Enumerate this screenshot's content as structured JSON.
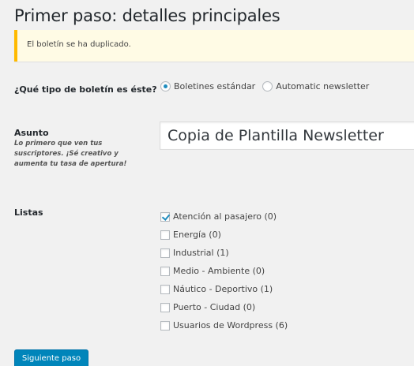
{
  "page_title": "Primer paso: detalles principales",
  "notice": {
    "text": "El boletín se ha duplicado."
  },
  "newsletter_type": {
    "label": "¿Qué tipo de boletín es éste?",
    "options": [
      {
        "label": "Boletines estándar",
        "selected": true
      },
      {
        "label": "Automatic newsletter",
        "selected": false
      }
    ]
  },
  "subject": {
    "label": "Asunto",
    "help": "Lo primero que ven tus suscriptores. ¡Sé creativo y aumenta tu tasa de apertura!",
    "value": "Copia de Plantilla Newsletter"
  },
  "lists": {
    "label": "Listas",
    "items": [
      {
        "label": "Atención al pasajero (0)",
        "checked": true
      },
      {
        "label": "Energía (0)",
        "checked": false
      },
      {
        "label": "Industrial (1)",
        "checked": false
      },
      {
        "label": "Medio - Ambiente (0)",
        "checked": false
      },
      {
        "label": "Náutico - Deportivo (1)",
        "checked": false
      },
      {
        "label": "Puerto - Ciudad (0)",
        "checked": false
      },
      {
        "label": "Usuarios de Wordpress (6)",
        "checked": false
      }
    ]
  },
  "next_button": {
    "label": "Siguiente paso"
  },
  "colors": {
    "accent": "#0085ba",
    "notice_border": "#ffba00",
    "notice_bg": "#fffbe5",
    "background": "#f1f1f1"
  }
}
